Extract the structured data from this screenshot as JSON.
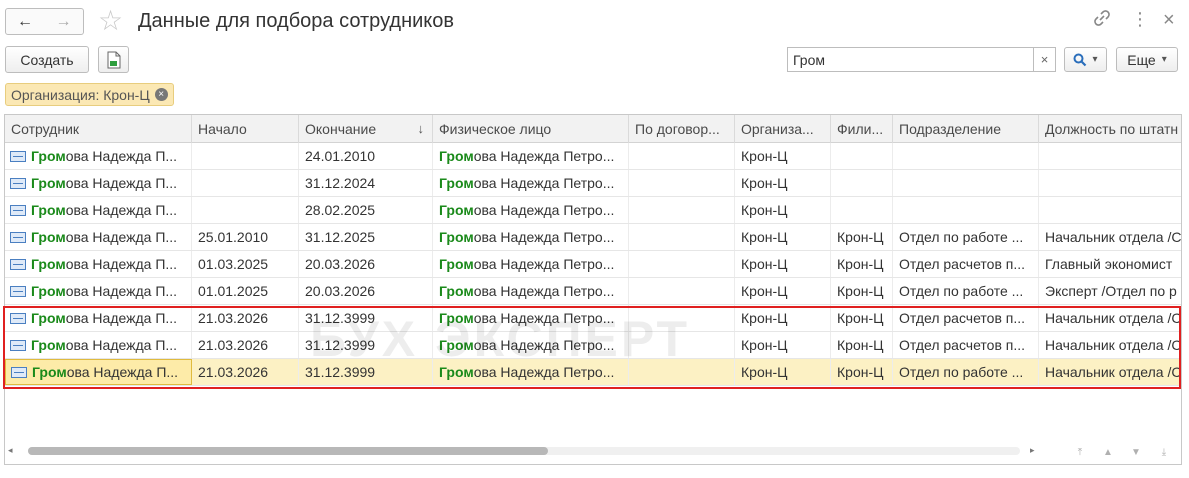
{
  "window": {
    "title": "Данные для подбора сотрудников",
    "back_icon": "←",
    "forward_icon": "→",
    "favorite_icon": "☆",
    "link_icon": "🔗",
    "more_icon": "⋮",
    "close_icon": "×"
  },
  "toolbar": {
    "create_label": "Создать",
    "excel_icon": "⇩",
    "search_value": "Гром",
    "search_clear": "×",
    "search_btn_icon": "🔍",
    "search_dropdown": "▾",
    "more_label": "Еще",
    "more_dropdown": "▾"
  },
  "filter": {
    "label": "Организация: Крон-Ц",
    "remove_icon": "×"
  },
  "watermark": "БУХ ЭКСПЕРТ",
  "table": {
    "columns": [
      "Сотрудник",
      "Начало",
      "Окончание",
      "Физическое лицо",
      "По договор...",
      "Организа...",
      "Фили...",
      "Подразделение",
      "Должность по штатн"
    ],
    "sort_indicator": "↓",
    "rows": [
      {
        "emp_hl": "Гром",
        "emp_rest": "ова Надежда П...",
        "start": "",
        "end": "24.01.2010",
        "fl_hl": "Гром",
        "fl_rest": "ова Надежда Петро...",
        "contract": "",
        "org": "Крон-Ц",
        "branch": "",
        "dept": "",
        "pos": ""
      },
      {
        "emp_hl": "Гром",
        "emp_rest": "ова Надежда П...",
        "start": "",
        "end": "31.12.2024",
        "fl_hl": "Гром",
        "fl_rest": "ова Надежда Петро...",
        "contract": "",
        "org": "Крон-Ц",
        "branch": "",
        "dept": "",
        "pos": ""
      },
      {
        "emp_hl": "Гром",
        "emp_rest": "ова Надежда П...",
        "start": "",
        "end": "28.02.2025",
        "fl_hl": "Гром",
        "fl_rest": "ова Надежда Петро...",
        "contract": "",
        "org": "Крон-Ц",
        "branch": "",
        "dept": "",
        "pos": ""
      },
      {
        "emp_hl": "Гром",
        "emp_rest": "ова Надежда П...",
        "start": "25.01.2010",
        "end": "31.12.2025",
        "fl_hl": "Гром",
        "fl_rest": "ова Надежда Петро...",
        "contract": "",
        "org": "Крон-Ц",
        "branch": "Крон-Ц",
        "dept": "Отдел по работе ...",
        "pos": "Начальник отдела /С"
      },
      {
        "emp_hl": "Гром",
        "emp_rest": "ова Надежда П...",
        "start": "01.03.2025",
        "end": "20.03.2026",
        "fl_hl": "Гром",
        "fl_rest": "ова Надежда Петро...",
        "contract": "",
        "org": "Крон-Ц",
        "branch": "Крон-Ц",
        "dept": "Отдел расчетов п...",
        "pos": "Главный экономист"
      },
      {
        "emp_hl": "Гром",
        "emp_rest": "ова Надежда П...",
        "start": "01.01.2025",
        "end": "20.03.2026",
        "fl_hl": "Гром",
        "fl_rest": "ова Надежда Петро...",
        "contract": "",
        "org": "Крон-Ц",
        "branch": "Крон-Ц",
        "dept": "Отдел по работе ...",
        "pos": "Эксперт /Отдел по р"
      },
      {
        "emp_hl": "Гром",
        "emp_rest": "ова Надежда П...",
        "start": "21.03.2026",
        "end": "31.12.3999",
        "fl_hl": "Гром",
        "fl_rest": "ова Надежда Петро...",
        "contract": "",
        "org": "Крон-Ц",
        "branch": "Крон-Ц",
        "dept": "Отдел расчетов п...",
        "pos": "Начальник отдела /С"
      },
      {
        "emp_hl": "Гром",
        "emp_rest": "ова Надежда П...",
        "start": "21.03.2026",
        "end": "31.12.3999",
        "fl_hl": "Гром",
        "fl_rest": "ова Надежда Петро...",
        "contract": "",
        "org": "Крон-Ц",
        "branch": "Крон-Ц",
        "dept": "Отдел расчетов п...",
        "pos": "Начальник отдела /С"
      },
      {
        "emp_hl": "Гром",
        "emp_rest": "ова Надежда П...",
        "start": "21.03.2026",
        "end": "31.12.3999",
        "fl_hl": "Гром",
        "fl_rest": "ова Надежда Петро...",
        "contract": "",
        "org": "Крон-Ц",
        "branch": "Крон-Ц",
        "dept": "Отдел по работе ...",
        "pos": "Начальник отдела /С",
        "selected": true
      }
    ]
  },
  "scroll": {
    "left_arrow": "◂",
    "right_arrow": "▸",
    "nav_first": "⤒",
    "nav_up": "▲",
    "nav_down": "▼",
    "nav_last": "⤓"
  }
}
